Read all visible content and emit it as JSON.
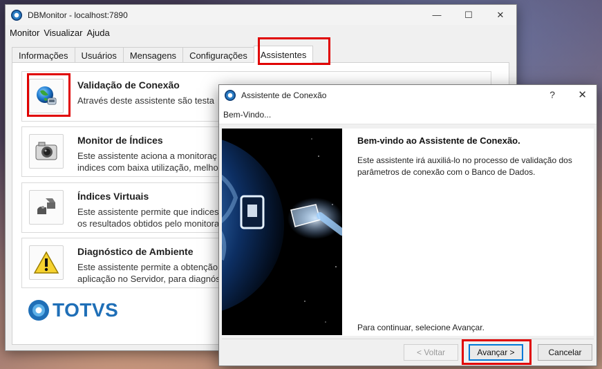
{
  "main_window": {
    "title": "DBMonitor - localhost:7890",
    "controls": {
      "minimize": "—",
      "maximize": "☐",
      "close": "✕"
    }
  },
  "menu": [
    "Monitor",
    "Visualizar",
    "Ajuda"
  ],
  "tabs": [
    {
      "label": "Informações"
    },
    {
      "label": "Usuários"
    },
    {
      "label": "Mensagens"
    },
    {
      "label": "Configurações"
    },
    {
      "label": "Assistentes",
      "active": true
    }
  ],
  "cards": [
    {
      "title": "Validação de Conexão",
      "desc": "Através deste assistente são testa",
      "icon": "globe-network-icon"
    },
    {
      "title": "Monitor de Índices",
      "desc": "Este assistente aciona a monitoraç\nindices com baixa utilização, melho",
      "icon": "camera-icon"
    },
    {
      "title": "Índices Virtuais",
      "desc": "Este assistente permite que indices\nos resultados obtidos pelo monitora",
      "icon": "shapes-icon"
    },
    {
      "title": "Diagnóstico de Ambiente",
      "desc": "Este assistente permite a obtenção\naplicação no Servidor, para diagnós",
      "icon": "warning-icon"
    }
  ],
  "logo": {
    "text": "TOTVS"
  },
  "dialog": {
    "title": "Assistente de Conexão",
    "help": "?",
    "close": "✕",
    "header": "Bem-Vindo...",
    "welcome_title": "Bem-vindo ao Assistente de Conexão.",
    "welcome_text": "Este assistente irá auxiliá-lo no processo de validação dos parâmetros de conexão com o Banco de Dados.",
    "footer_text": "Para continuar, selecione Avançar.",
    "buttons": {
      "back": "< Voltar",
      "next": "Avançar >",
      "cancel": "Cancelar"
    }
  },
  "colors": {
    "highlight": "#e00000",
    "brand": "#1f6fb7",
    "accent": "#0078d7"
  }
}
